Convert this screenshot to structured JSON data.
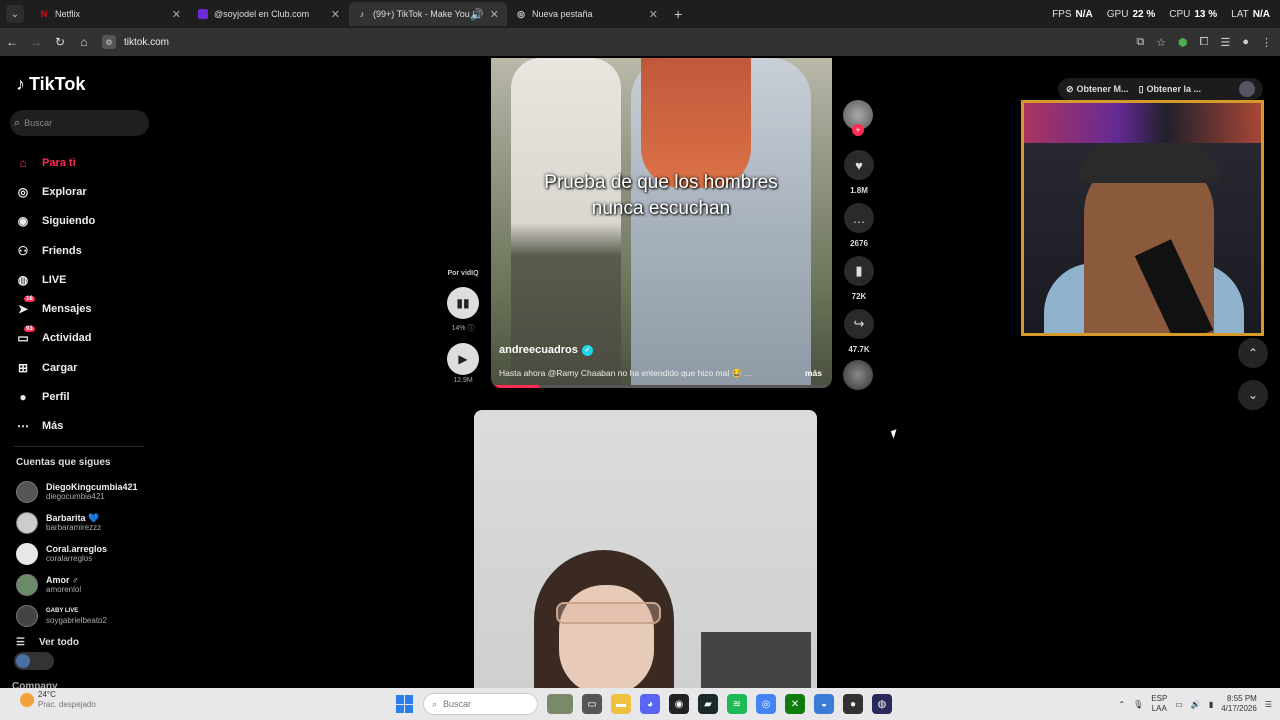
{
  "browser": {
    "tabs": [
      {
        "title": "Netflix",
        "icon": "netflix-icon",
        "active": false
      },
      {
        "title": "@soyjodel en Club.com",
        "icon": "club-icon",
        "active": false
      },
      {
        "title": "(99+) TikTok - Make Your Da",
        "icon": "tiktok-icon",
        "active": true
      },
      {
        "title": "Nueva pestaña",
        "icon": "chrome-icon",
        "active": false
      }
    ],
    "url": "tiktok.com",
    "stats": {
      "fps_label": "FPS",
      "fps": "N/A",
      "gpu_label": "GPU",
      "gpu": "22 %",
      "cpu_label": "CPU",
      "cpu": "13 %",
      "lat_label": "LAT",
      "lat": "N/A"
    }
  },
  "sidebar": {
    "logo": "TikTok",
    "search_placeholder": "Buscar",
    "nav": [
      {
        "label": "Para ti",
        "icon": "home-icon",
        "active": true
      },
      {
        "label": "Explorar",
        "icon": "compass-icon"
      },
      {
        "label": "Siguiendo",
        "icon": "following-icon"
      },
      {
        "label": "Friends",
        "icon": "friends-icon"
      },
      {
        "label": "LIVE",
        "icon": "live-icon"
      },
      {
        "label": "Mensajes",
        "icon": "messages-icon",
        "badge": "16"
      },
      {
        "label": "Actividad",
        "icon": "activity-icon",
        "badge": "93"
      },
      {
        "label": "Cargar",
        "icon": "upload-icon"
      },
      {
        "label": "Perfil",
        "icon": "profile-icon"
      },
      {
        "label": "Más",
        "icon": "more-icon"
      }
    ],
    "following_title": "Cuentas que sigues",
    "following": [
      {
        "name": "DiegoKingcumbia421",
        "user": "diegocumbia421"
      },
      {
        "name": "Barbarita 💙",
        "user": "barbaramirezzz"
      },
      {
        "name": "Coral.arreglos",
        "user": "coralarreglos"
      },
      {
        "name": "Amor ♂",
        "user": "amorenlol"
      },
      {
        "name": "GABY LIVE",
        "user": "soygabrielbeato2"
      }
    ],
    "see_all": "Ver todo",
    "company": "Company"
  },
  "video1": {
    "caption": "Prueba de que los hombres nunca escuchan",
    "author": "andreecuadros",
    "description": "Hasta ahora @Ramy Chaaban no ha entendido que hizo mal 😂 ...",
    "more": "más",
    "progress": 0.14
  },
  "actions": {
    "likes": "1.8M",
    "comments": "2676",
    "saves": "72K",
    "shares": "47.7K"
  },
  "left_controls": {
    "by": "Por vidIQ",
    "percent": "14%",
    "views": "12.9M"
  },
  "extension_bar": {
    "item1": "Obtener M...",
    "item2": "Obtener la ..."
  },
  "taskbar": {
    "temp": "24°C",
    "weather": "Prac. despejado",
    "search_placeholder": "Buscar",
    "lang1": "ESP",
    "lang2": "LAA",
    "time": "8:55 PM",
    "date": "4/17/2026"
  }
}
